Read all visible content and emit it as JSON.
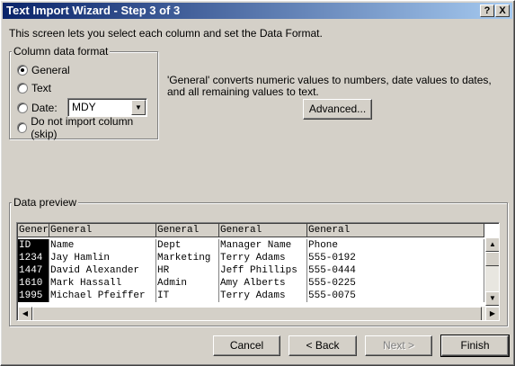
{
  "window": {
    "title": "Text Import Wizard - Step 3 of 3",
    "help_label": "?",
    "close_label": "X"
  },
  "instructions": "This screen lets you select each column and set the Data Format.",
  "column_format": {
    "legend": "Column data format",
    "options": [
      {
        "label": "General",
        "selected": true
      },
      {
        "label": "Text",
        "selected": false
      },
      {
        "label": "Date:",
        "selected": false
      },
      {
        "label": "Do not import column (skip)",
        "selected": false
      }
    ],
    "date_format_value": "MDY"
  },
  "description": "'General' converts numeric values to numbers, date values to dates, and all remaining values to text.",
  "advanced_label": "Advanced...",
  "preview": {
    "legend": "Data preview",
    "headers": [
      "Gener",
      "General",
      "General",
      "General",
      "General"
    ],
    "rows": [
      [
        "ID",
        "Name",
        "Dept",
        "Manager Name",
        "Phone"
      ],
      [
        "1234",
        "Jay Hamlin",
        "Marketing",
        "Terry Adams",
        "555-0192"
      ],
      [
        "1447",
        "David Alexander",
        "HR",
        "Jeff Phillips",
        "555-0444"
      ],
      [
        "1610",
        "Mark Hassall",
        "Admin",
        "Amy Alberts",
        "555-0225"
      ],
      [
        "1995",
        "Michael Pfeiffer",
        "IT",
        "Terry Adams",
        "555-0075"
      ]
    ]
  },
  "buttons": {
    "cancel": "Cancel",
    "back": "< Back",
    "next": "Next >",
    "finish": "Finish"
  }
}
